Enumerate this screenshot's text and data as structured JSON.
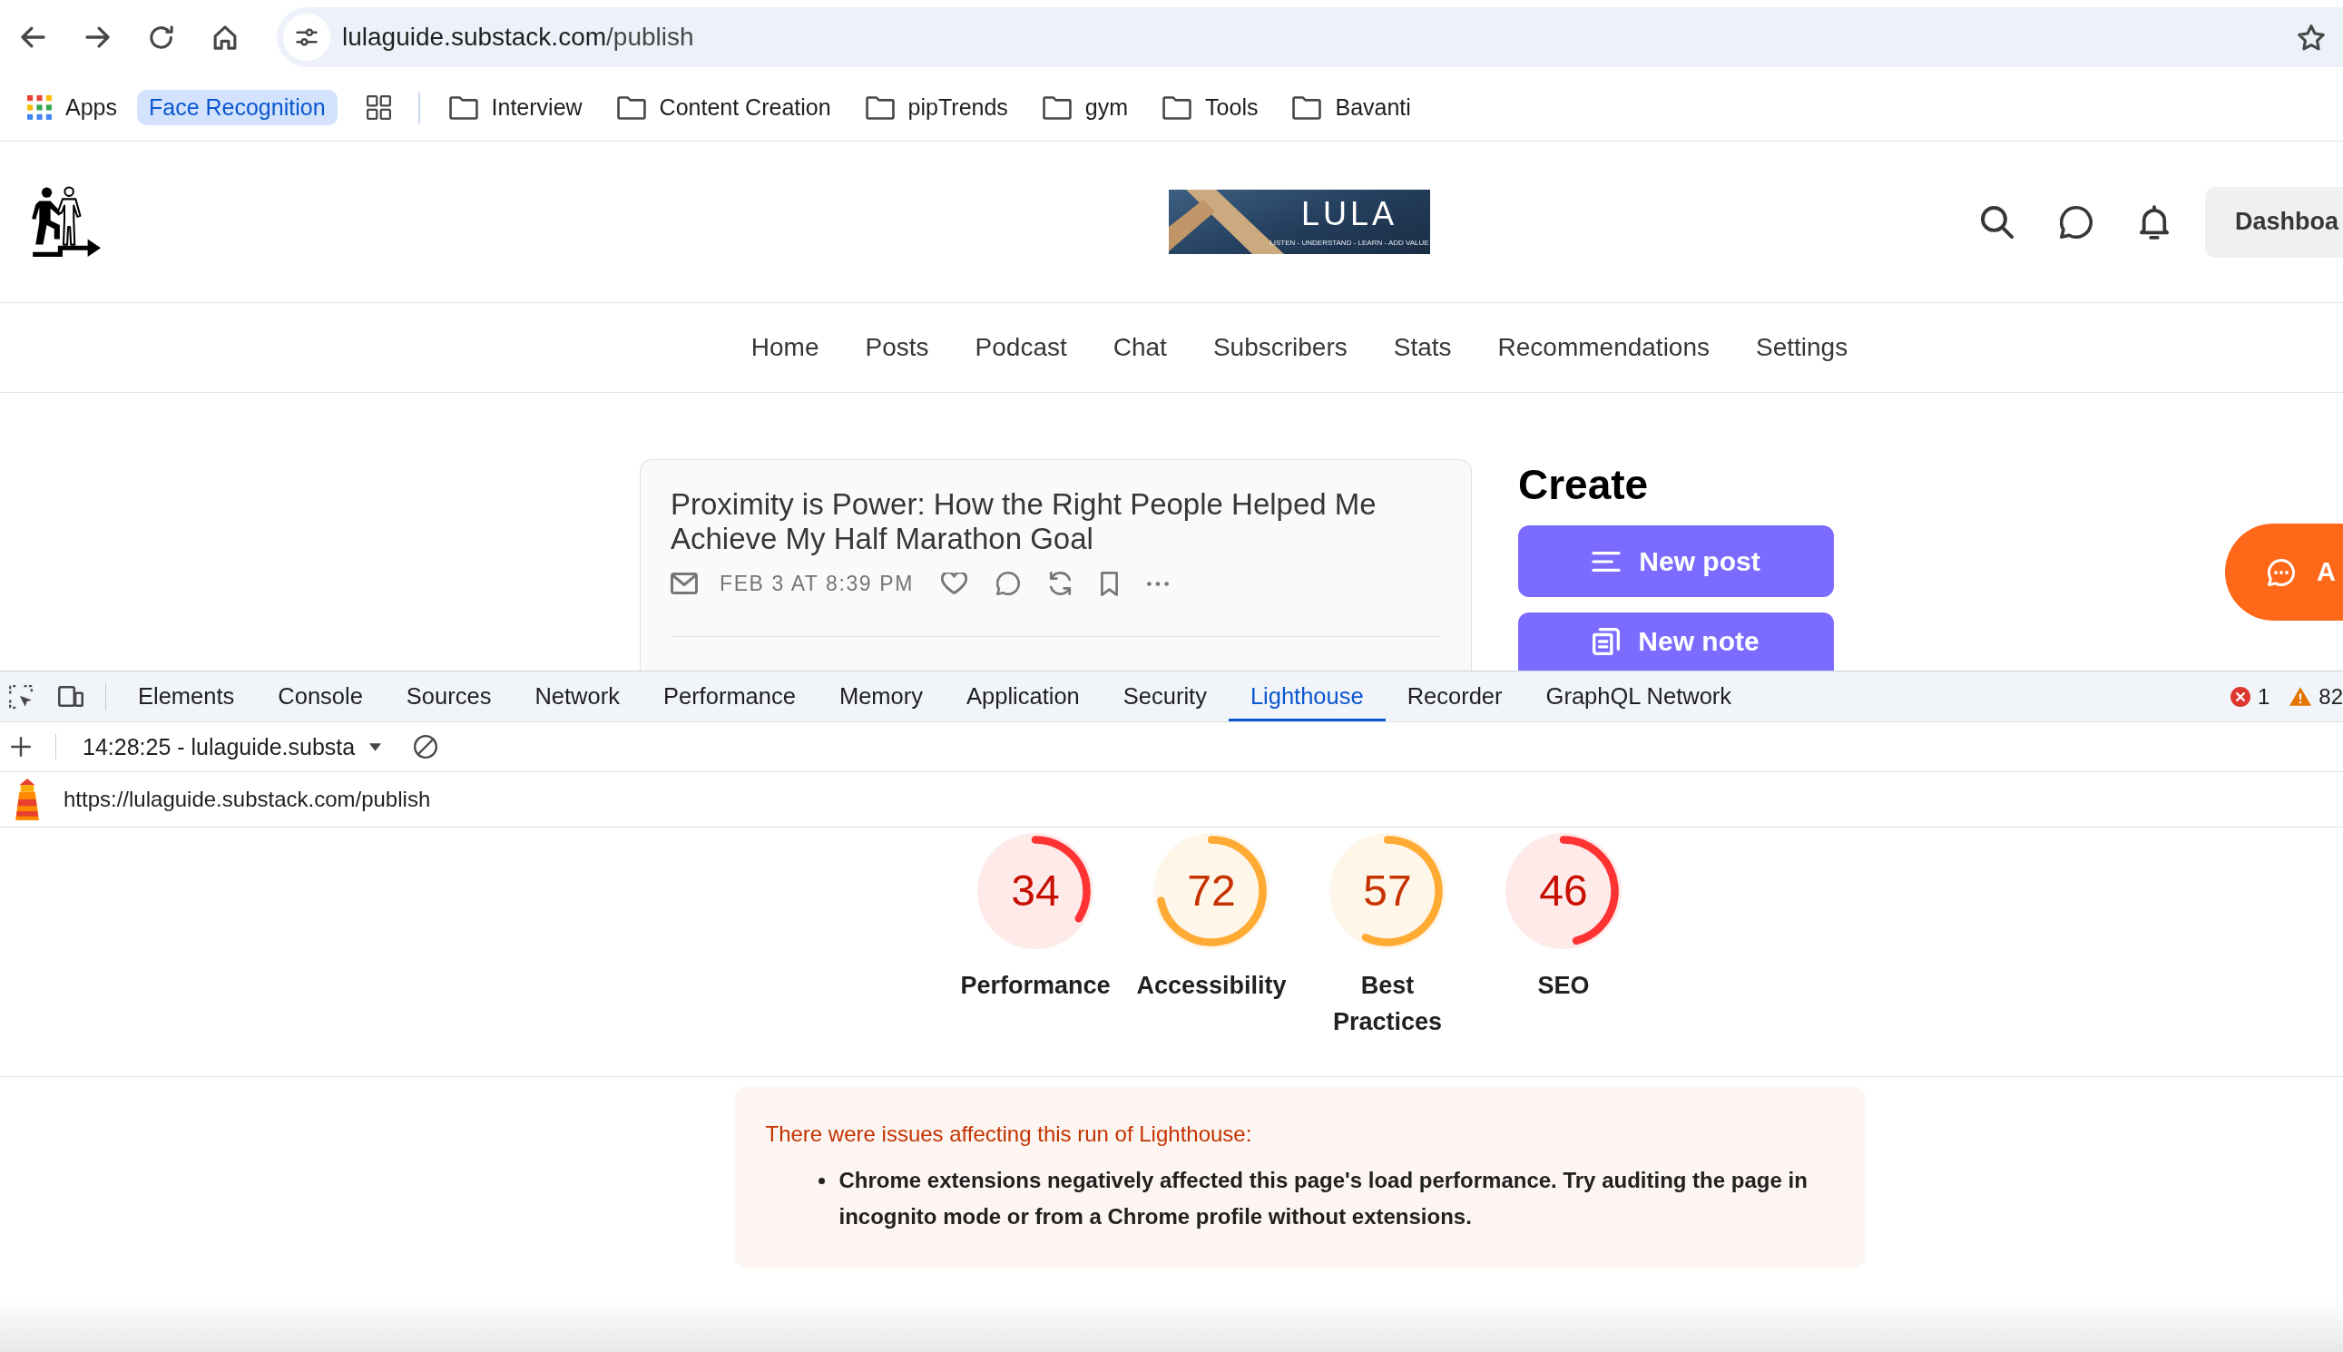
{
  "browser": {
    "address": {
      "host": "lulaguide.substack.com",
      "path": "/publish"
    },
    "bookmarks": [
      {
        "kind": "apps",
        "label": "Apps"
      },
      {
        "kind": "group",
        "label": "Face Recognition"
      },
      {
        "kind": "folder",
        "label": "Interview"
      },
      {
        "kind": "folder",
        "label": "Content Creation"
      },
      {
        "kind": "folder",
        "label": "pipTrends"
      },
      {
        "kind": "folder",
        "label": "gym"
      },
      {
        "kind": "folder",
        "label": "Tools"
      },
      {
        "kind": "folder",
        "label": "Bavanti"
      }
    ]
  },
  "publication": {
    "banner": {
      "title": "LULA",
      "tagline": "LISTEN - UNDERSTAND - LEARN - ADD VALUE"
    },
    "dashboard_button": "Dashboa",
    "nav": [
      "Home",
      "Posts",
      "Podcast",
      "Chat",
      "Subscribers",
      "Stats",
      "Recommendations",
      "Settings"
    ]
  },
  "post": {
    "title": "Proximity is Power: How the Right People Helped Me Achieve My Half Marathon Goal",
    "date": "FEB 3 AT 8:39 PM"
  },
  "create": {
    "title": "Create",
    "buttons": [
      {
        "kind": "post",
        "label": "New post"
      },
      {
        "kind": "note",
        "label": "New note"
      }
    ]
  },
  "chat_button": {
    "label": "A"
  },
  "devtools": {
    "tabs": [
      {
        "label": "Elements",
        "selected": false
      },
      {
        "label": "Console",
        "selected": false
      },
      {
        "label": "Sources",
        "selected": false
      },
      {
        "label": "Network",
        "selected": false
      },
      {
        "label": "Performance",
        "selected": false
      },
      {
        "label": "Memory",
        "selected": false
      },
      {
        "label": "Application",
        "selected": false
      },
      {
        "label": "Security",
        "selected": false
      },
      {
        "label": "Lighthouse",
        "selected": true
      },
      {
        "label": "Recorder",
        "selected": false
      },
      {
        "label": "GraphQL Network",
        "selected": false
      }
    ],
    "errors": "1",
    "warnings": "82",
    "report": "14:28:25 - lulaguide.substa",
    "url": "https://lulaguide.substack.com/publish"
  },
  "lighthouse": {
    "scores": [
      {
        "value": "34",
        "label": "Performance",
        "color": "#ff3333"
      },
      {
        "value": "72",
        "label": "Accessibility",
        "color": "#ffaa33"
      },
      {
        "value": "57",
        "label": "Best Practices",
        "color": "#ffaa33"
      },
      {
        "value": "46",
        "label": "SEO",
        "color": "#ff3333"
      }
    ],
    "warning": {
      "title": "There were issues affecting this run of Lighthouse:",
      "items": [
        "Chrome extensions negatively affected this page's load performance. Try auditing the page in incognito mode or from a Chrome profile without extensions."
      ]
    }
  }
}
